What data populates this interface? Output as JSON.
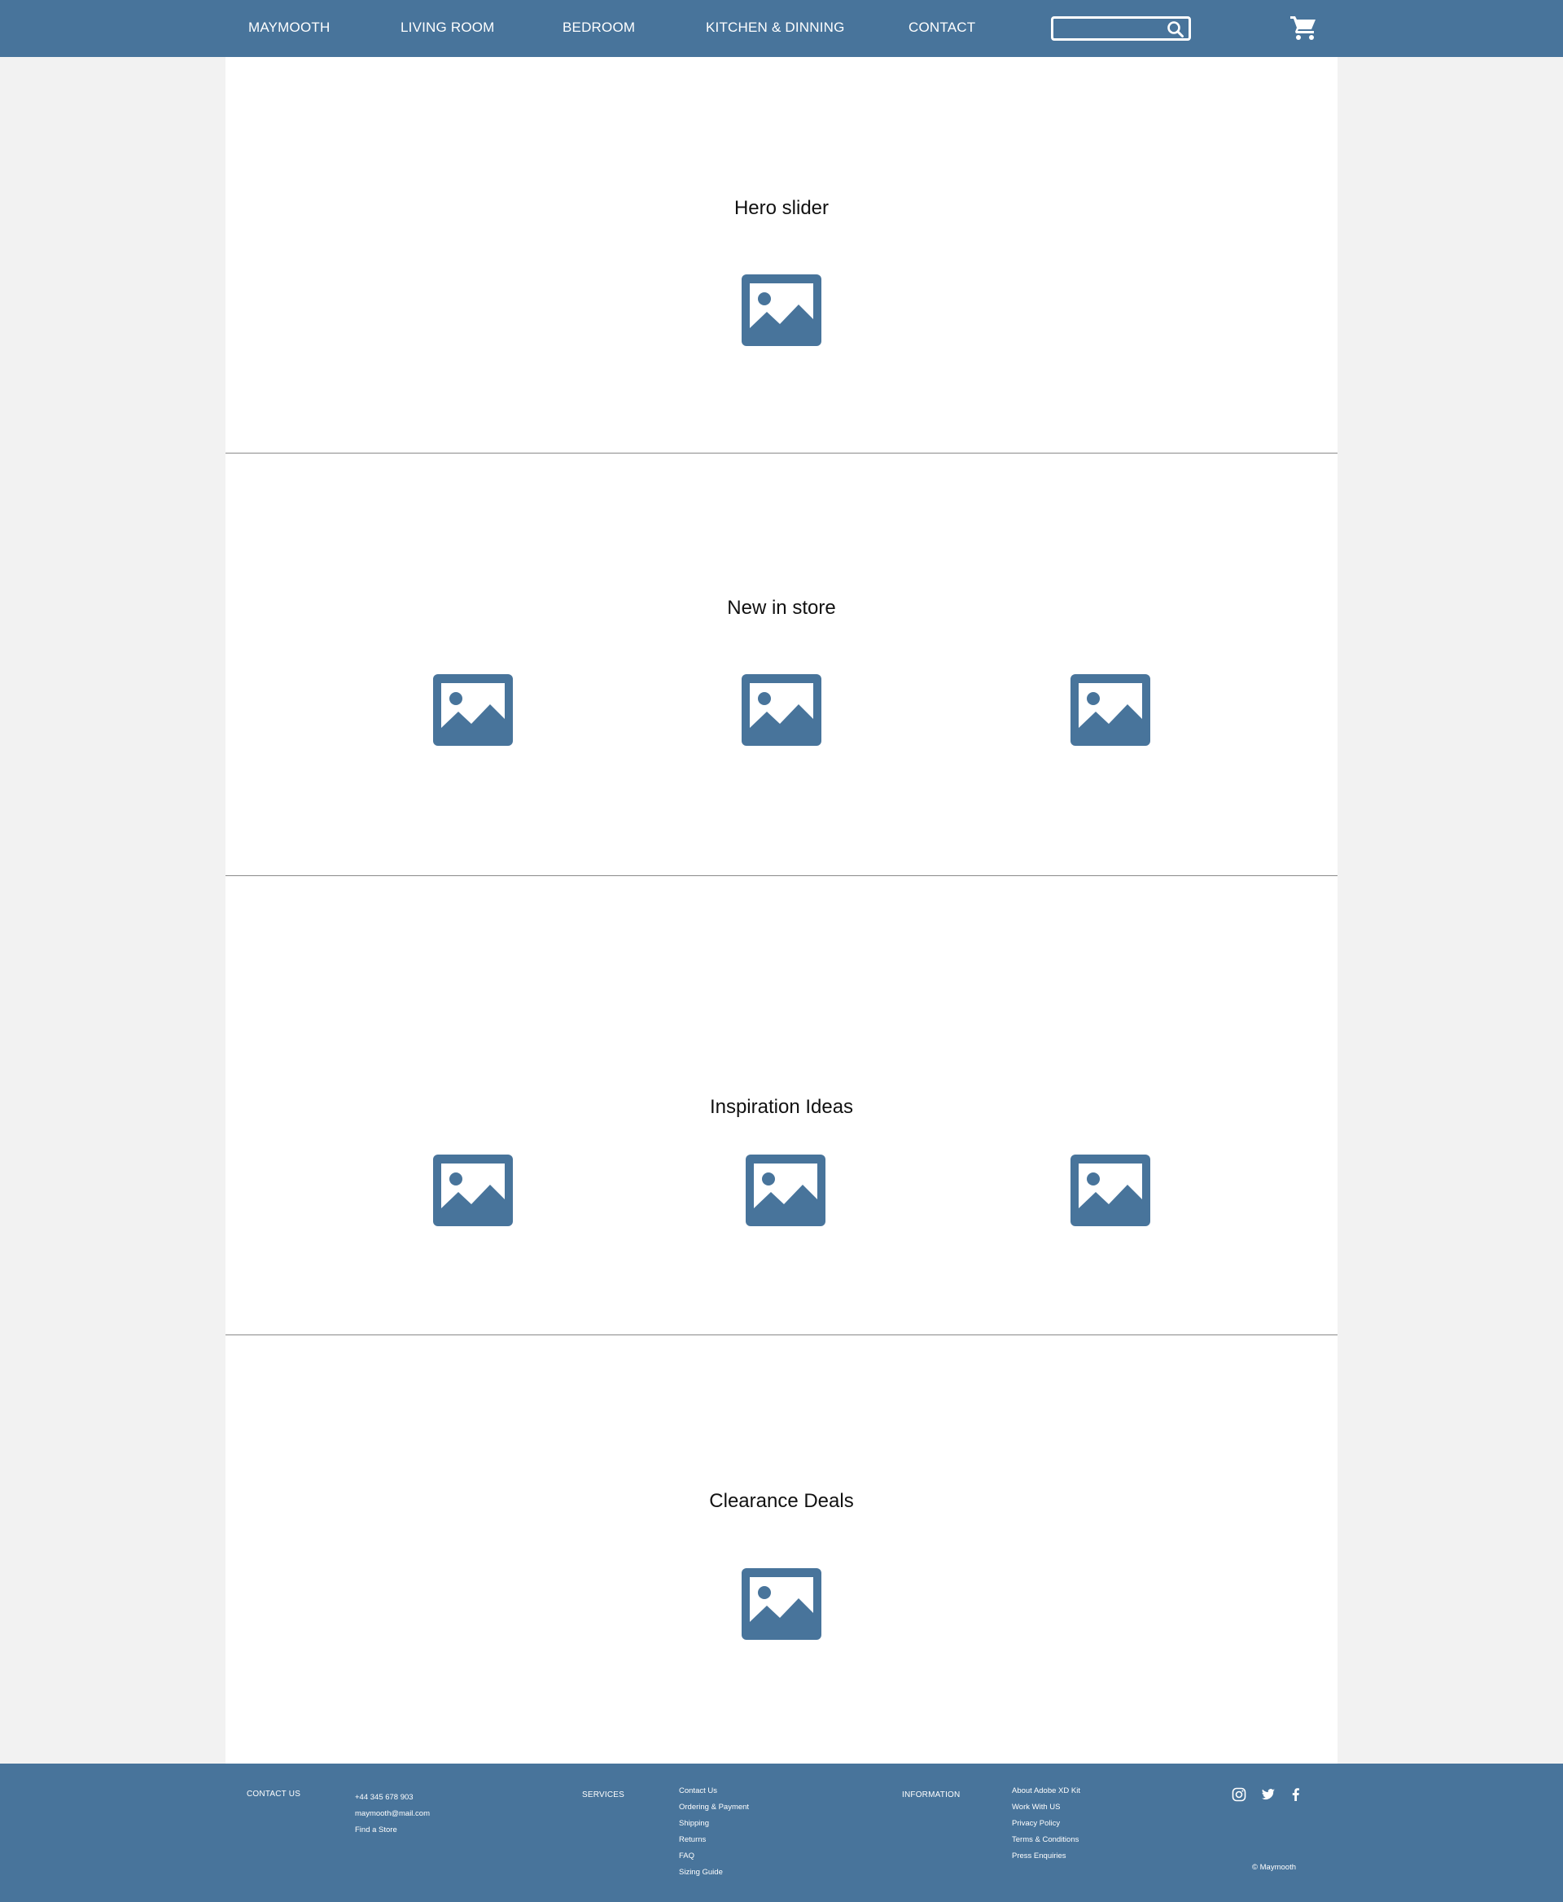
{
  "nav": {
    "items": [
      "MAYMOOTH",
      "LIVING ROOM",
      "BEDROOM",
      "KITCHEN & DINNING",
      "CONTACT"
    ],
    "search_placeholder": ""
  },
  "sections": {
    "hero": {
      "title": "Hero slider"
    },
    "new": {
      "title": "New in store"
    },
    "inspiration": {
      "title": "Inspiration Ideas"
    },
    "clearance": {
      "title": "Clearance Deals"
    }
  },
  "footer": {
    "contact_heading": "CONTACT US",
    "contact_items": [
      "+44 345 678 903",
      "maymooth@mail.com",
      "Find a Store"
    ],
    "services_heading": "SERVICES",
    "services_items": [
      "Contact Us",
      "Ordering & Payment",
      "Shipping",
      "Returns",
      "FAQ",
      "Sizing Guide"
    ],
    "information_heading": "INFORMATION",
    "information_items": [
      "About Adobe XD Kit",
      "Work With US",
      "Privacy Policy",
      "Terms & Conditions",
      "Press Enquiries"
    ],
    "social": [
      "instagram-icon",
      "twitter-icon",
      "facebook-icon"
    ],
    "copyright": "© Maymooth"
  },
  "colors": {
    "brand": "#48749b",
    "page_bg": "#f2f2f2",
    "content_bg": "#ffffff"
  }
}
